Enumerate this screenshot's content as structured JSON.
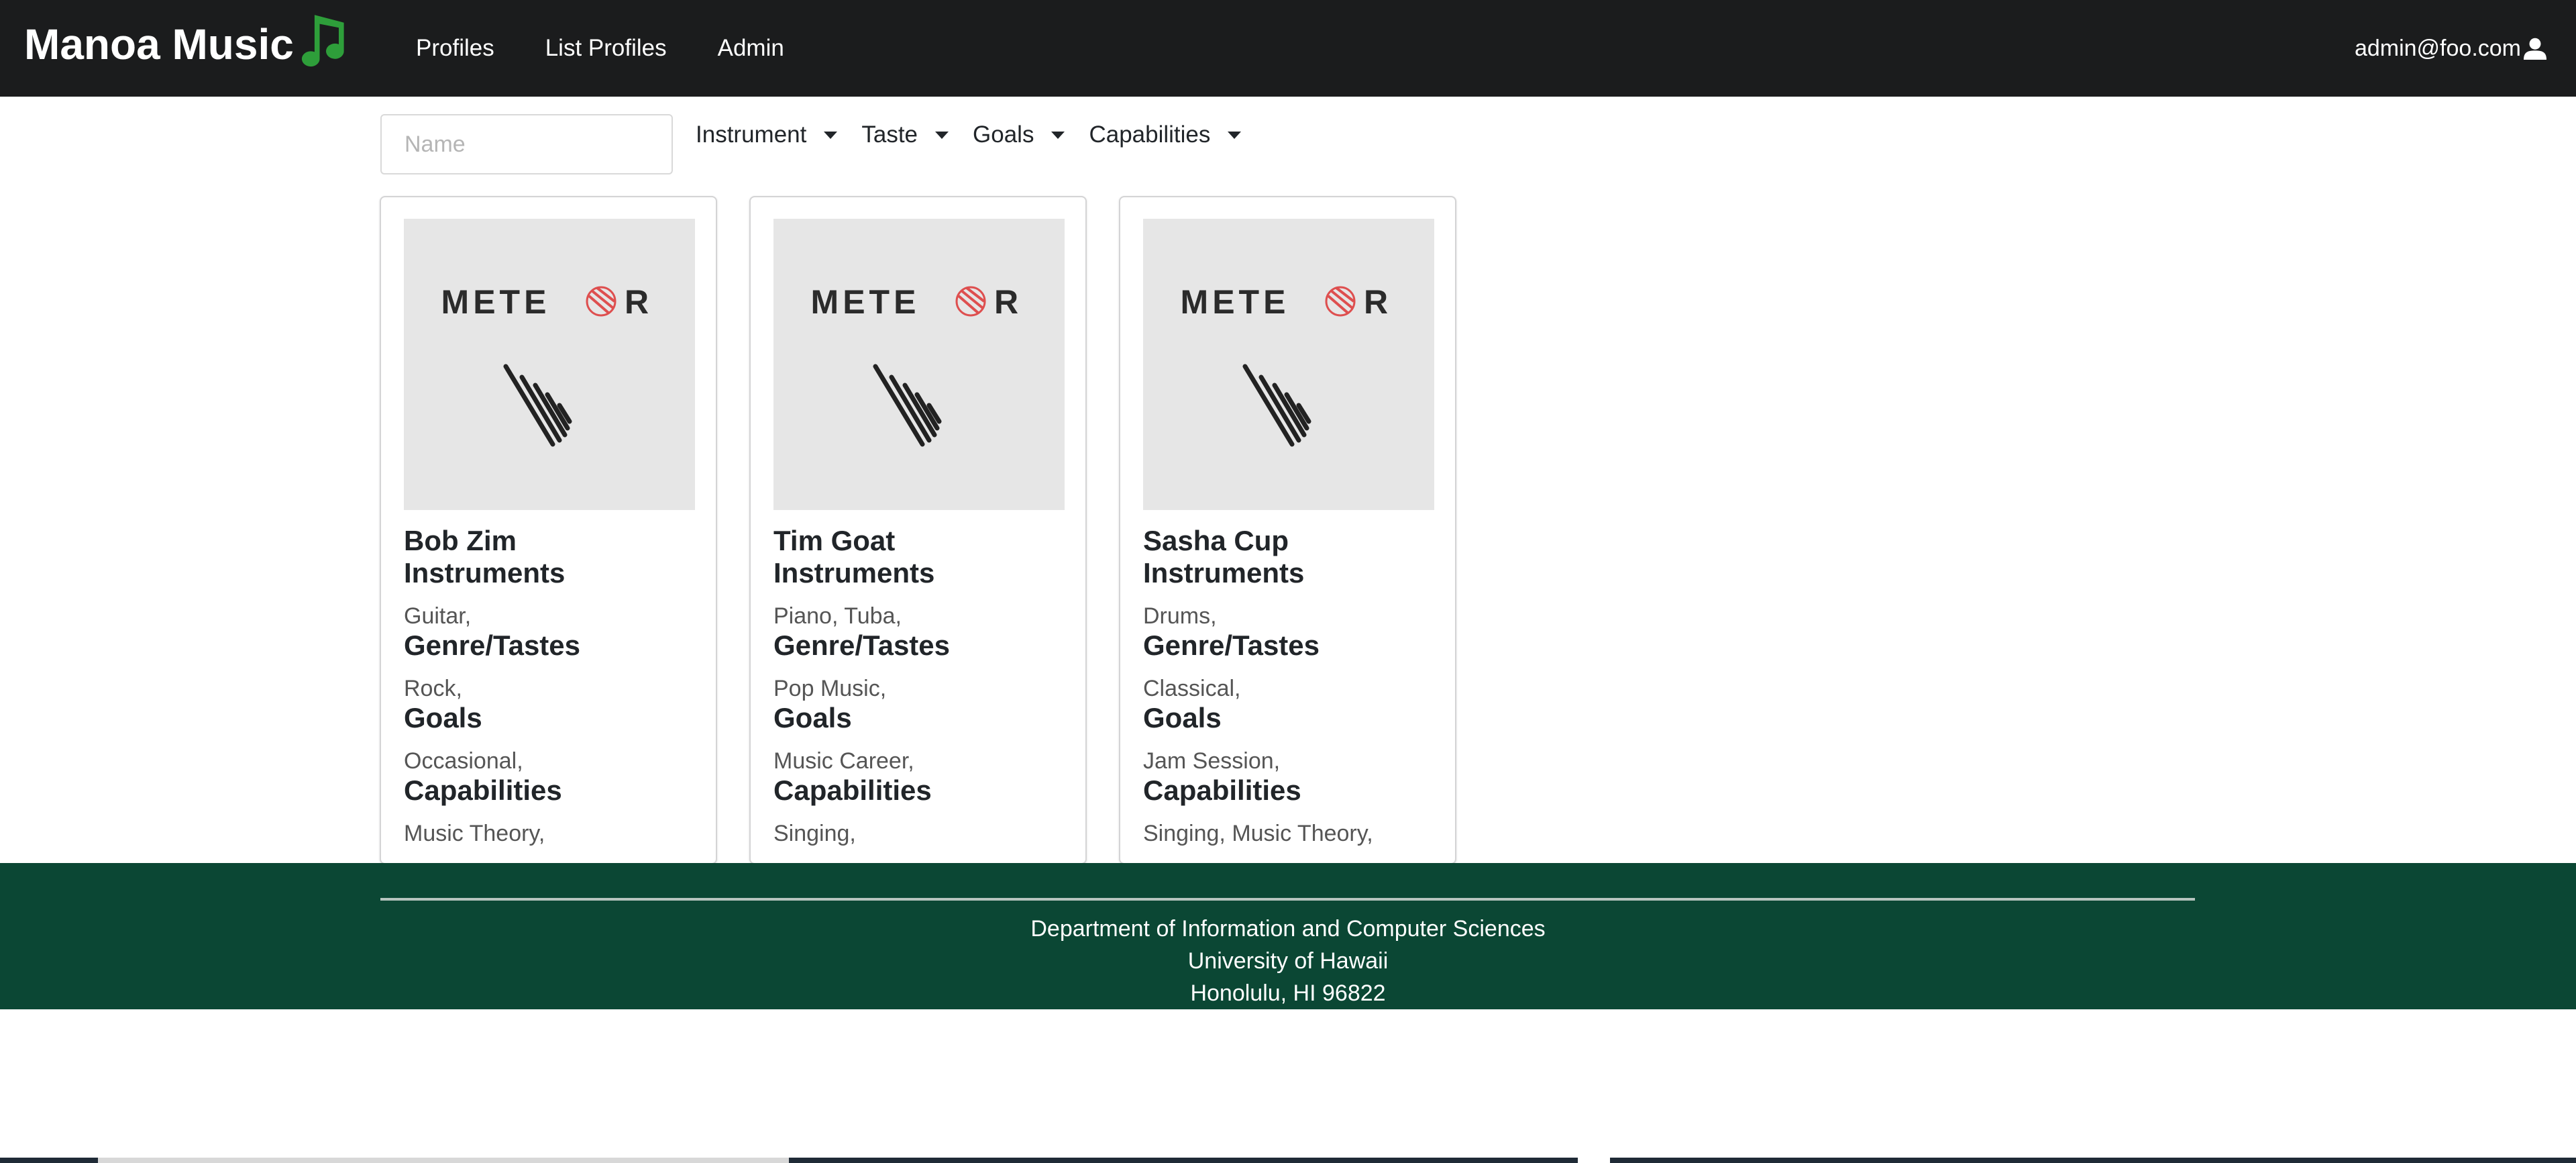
{
  "navbar": {
    "brand": "Manoa Music",
    "links": [
      "Profiles",
      "List Profiles",
      "Admin"
    ],
    "user": "admin@foo.com",
    "brand_icon": "music-note-icon",
    "user_icon": "user-icon"
  },
  "filters": {
    "name_placeholder": "Name",
    "dropdowns": [
      "Instrument",
      "Taste",
      "Goals",
      "Capabilities"
    ]
  },
  "cards": [
    {
      "name": "Bob Zim",
      "image_text": "METEOR",
      "instruments_title": "Instruments",
      "instruments": "Guitar,",
      "genre_title": "Genre/Tastes",
      "genre": "Rock,",
      "goals_title": "Goals",
      "goals": "Occasional,",
      "capabilities_title": "Capabilities",
      "capabilities": "Music Theory,"
    },
    {
      "name": "Tim Goat",
      "image_text": "METEOR",
      "instruments_title": "Instruments",
      "instruments": "Piano, Tuba,",
      "genre_title": "Genre/Tastes",
      "genre": "Pop Music,",
      "goals_title": "Goals",
      "goals": "Music Career,",
      "capabilities_title": "Capabilities",
      "capabilities": "Singing,"
    },
    {
      "name": "Sasha Cup",
      "image_text": "METEOR",
      "instruments_title": "Instruments",
      "instruments": "Drums,",
      "genre_title": "Genre/Tastes",
      "genre": "Classical,",
      "goals_title": "Goals",
      "goals": "Jam Session,",
      "capabilities_title": "Capabilities",
      "capabilities": "Singing, Music Theory,"
    }
  ],
  "footer": {
    "line1": "Department of Information and Computer Sciences",
    "line2": "University of Hawaii",
    "line3": "Honolulu, HI 96822"
  },
  "colors": {
    "navbar_bg": "#1b1c1d",
    "footer_bg": "#0b4734",
    "brand_note": "#2e9e3a",
    "meteor_accent": "#de4f4f"
  }
}
